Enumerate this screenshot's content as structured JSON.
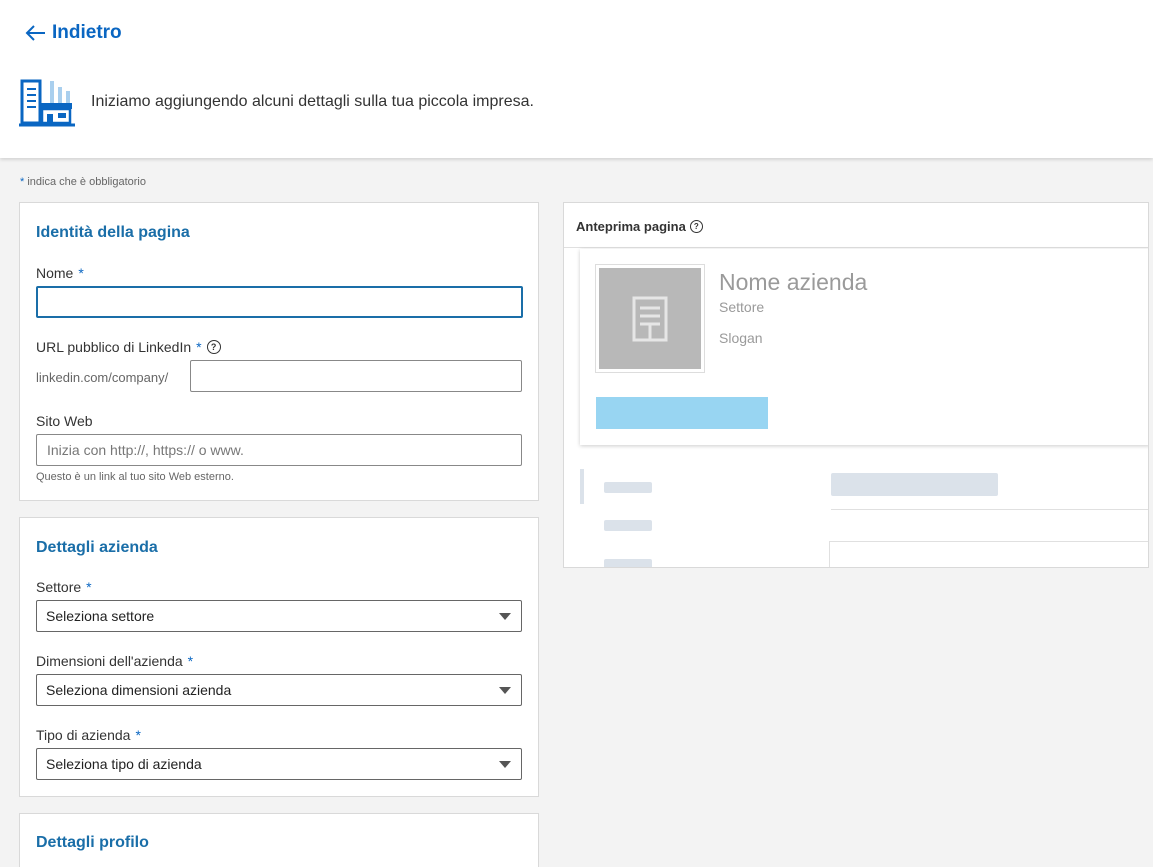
{
  "header": {
    "back_label": "Indietro",
    "intro": "Iniziamo aggiungendo alcuni dettagli sulla tua piccola impresa."
  },
  "required_note": {
    "star": "*",
    "text": " indica che è obbligatorio"
  },
  "identity": {
    "title": "Identità della pagina",
    "name_label": "Nome",
    "name_value": "",
    "url_label": "URL pubblico di LinkedIn",
    "url_prefix": "linkedin.com/company/",
    "url_value": "",
    "website_label": "Sito Web",
    "website_placeholder": "Inizia con http://, https:// o www.",
    "website_hint": "Questo è un link al tuo sito Web esterno."
  },
  "company": {
    "title": "Dettagli azienda",
    "sector_label": "Settore",
    "sector_value": "Seleziona settore",
    "size_label": "Dimensioni dell'azienda",
    "size_value": "Seleziona dimensioni azienda",
    "type_label": "Tipo di azienda",
    "type_value": "Seleziona tipo di azienda"
  },
  "profile": {
    "title": "Dettagli profilo"
  },
  "preview": {
    "title": "Anteprima pagina",
    "company_name": "Nome azienda",
    "sector": "Settore",
    "slogan": "Slogan"
  },
  "colors": {
    "accent": "#0a66c2",
    "title_blue": "#1a6ea8",
    "preview_button": "#98d5f2",
    "logo_placeholder": "#b8b8b8"
  }
}
